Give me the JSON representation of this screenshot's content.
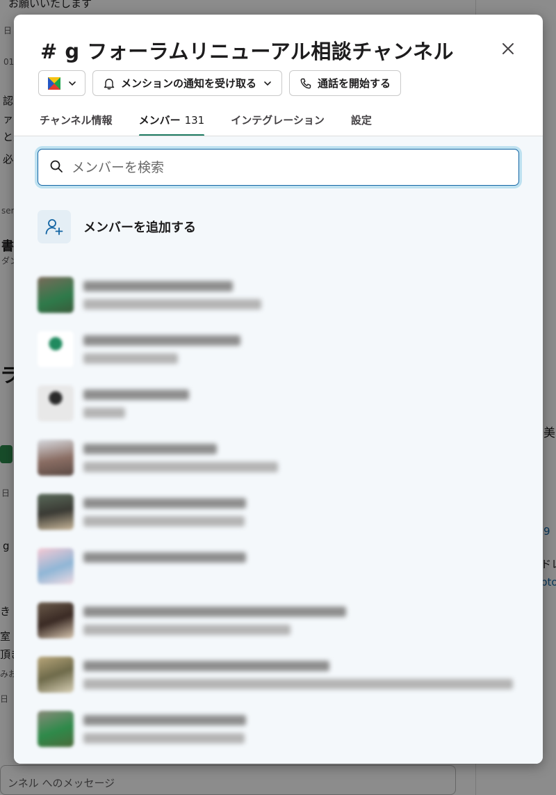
{
  "background_fragments": [
    "お願いいたします",
    "日",
    "01",
    "認",
    "ァ",
    "と果",
    "必要",
    "ser",
    "書",
    "ダン",
    "ラ",
    "日",
    "g",
    "き",
    "室",
    "頂き",
    "みお",
    "日",
    "美",
    "9",
    "ドレ",
    "pto"
  ],
  "background_composer_placeholder": "ンネル へのメッセージ",
  "modal": {
    "title": "# g フォーラムリニューアル相談チャンネル",
    "close_icon": "close-icon",
    "toolbar": {
      "notify_label": "メンションの通知を受け取る",
      "call_label": "通話を開始する"
    },
    "tabs": [
      {
        "label": "チャンネル情報",
        "count": ""
      },
      {
        "label": "メンバー",
        "count": "131"
      },
      {
        "label": "インテグレーション",
        "count": ""
      },
      {
        "label": "設定",
        "count": ""
      }
    ],
    "active_tab": "メンバー",
    "search": {
      "value": "",
      "placeholder": "メンバーを検索"
    },
    "add_member_label": "メンバーを追加する",
    "colors": {
      "accent": "#1d7a62",
      "focus_ring": "#1264a3",
      "panel_bg": "#f4f8fb"
    }
  }
}
